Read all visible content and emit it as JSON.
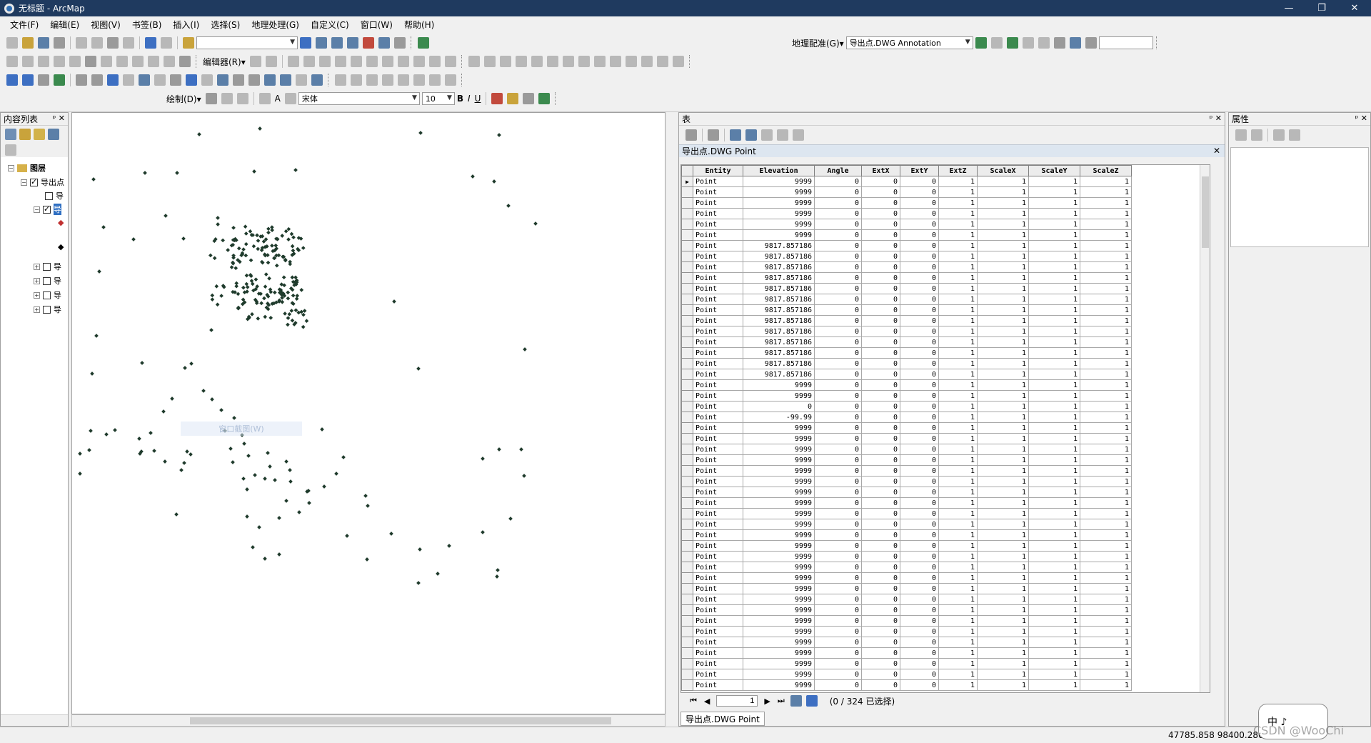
{
  "window": {
    "title": "无标题 - ArcMap",
    "minimize": "—",
    "restore": "❐",
    "close": "✕"
  },
  "menu": [
    "文件(F)",
    "编辑(E)",
    "视图(V)",
    "书签(B)",
    "插入(I)",
    "选择(S)",
    "地理处理(G)",
    "自定义(C)",
    "窗口(W)",
    "帮助(H)"
  ],
  "toolbar": {
    "georef_label": "地理配准(G)▾",
    "georef_layer": "导出点.DWG Annotation",
    "editor_label": "编辑器(R)▾",
    "draw_label": "绘制(D)▾",
    "font_name": "宋体",
    "font_size": "10",
    "bold": "B",
    "italic": "I",
    "underline": "U",
    "text_a": "A"
  },
  "toc": {
    "title": "内容列表",
    "pin": "ᵖ ✕",
    "root": "图层",
    "layer1": "导出点",
    "sublayers": [
      "导",
      "导",
      "导",
      "导",
      "导",
      "导"
    ]
  },
  "map": {
    "ghost_text": "窗口截图(W)"
  },
  "table_window": {
    "title": "表",
    "pin": "ᵖ ✕",
    "tab": "导出点.DWG Point",
    "columns": [
      "Entity",
      "Elevation",
      "Angle",
      "ExtX",
      "ExtY",
      "ExtZ",
      "ScaleX",
      "ScaleY",
      "ScaleZ"
    ],
    "rows": [
      [
        "Point",
        "9999",
        "0",
        "0",
        "0",
        "1",
        "1",
        "1",
        "1"
      ],
      [
        "Point",
        "9999",
        "0",
        "0",
        "0",
        "1",
        "1",
        "1",
        "1"
      ],
      [
        "Point",
        "9999",
        "0",
        "0",
        "0",
        "1",
        "1",
        "1",
        "1"
      ],
      [
        "Point",
        "9999",
        "0",
        "0",
        "0",
        "1",
        "1",
        "1",
        "1"
      ],
      [
        "Point",
        "9999",
        "0",
        "0",
        "0",
        "1",
        "1",
        "1",
        "1"
      ],
      [
        "Point",
        "9999",
        "0",
        "0",
        "0",
        "1",
        "1",
        "1",
        "1"
      ],
      [
        "Point",
        "9817.857186",
        "0",
        "0",
        "0",
        "1",
        "1",
        "1",
        "1"
      ],
      [
        "Point",
        "9817.857186",
        "0",
        "0",
        "0",
        "1",
        "1",
        "1",
        "1"
      ],
      [
        "Point",
        "9817.857186",
        "0",
        "0",
        "0",
        "1",
        "1",
        "1",
        "1"
      ],
      [
        "Point",
        "9817.857186",
        "0",
        "0",
        "0",
        "1",
        "1",
        "1",
        "1"
      ],
      [
        "Point",
        "9817.857186",
        "0",
        "0",
        "0",
        "1",
        "1",
        "1",
        "1"
      ],
      [
        "Point",
        "9817.857186",
        "0",
        "0",
        "0",
        "1",
        "1",
        "1",
        "1"
      ],
      [
        "Point",
        "9817.857186",
        "0",
        "0",
        "0",
        "1",
        "1",
        "1",
        "1"
      ],
      [
        "Point",
        "9817.857186",
        "0",
        "0",
        "0",
        "1",
        "1",
        "1",
        "1"
      ],
      [
        "Point",
        "9817.857186",
        "0",
        "0",
        "0",
        "1",
        "1",
        "1",
        "1"
      ],
      [
        "Point",
        "9817.857186",
        "0",
        "0",
        "0",
        "1",
        "1",
        "1",
        "1"
      ],
      [
        "Point",
        "9817.857186",
        "0",
        "0",
        "0",
        "1",
        "1",
        "1",
        "1"
      ],
      [
        "Point",
        "9817.857186",
        "0",
        "0",
        "0",
        "1",
        "1",
        "1",
        "1"
      ],
      [
        "Point",
        "9817.857186",
        "0",
        "0",
        "0",
        "1",
        "1",
        "1",
        "1"
      ],
      [
        "Point",
        "9999",
        "0",
        "0",
        "0",
        "1",
        "1",
        "1",
        "1"
      ],
      [
        "Point",
        "9999",
        "0",
        "0",
        "0",
        "1",
        "1",
        "1",
        "1"
      ],
      [
        "Point",
        "0",
        "0",
        "0",
        "0",
        "1",
        "1",
        "1",
        "1"
      ],
      [
        "Point",
        "-99.99",
        "0",
        "0",
        "0",
        "1",
        "1",
        "1",
        "1"
      ],
      [
        "Point",
        "9999",
        "0",
        "0",
        "0",
        "1",
        "1",
        "1",
        "1"
      ],
      [
        "Point",
        "9999",
        "0",
        "0",
        "0",
        "1",
        "1",
        "1",
        "1"
      ],
      [
        "Point",
        "9999",
        "0",
        "0",
        "0",
        "1",
        "1",
        "1",
        "1"
      ],
      [
        "Point",
        "9999",
        "0",
        "0",
        "0",
        "1",
        "1",
        "1",
        "1"
      ],
      [
        "Point",
        "9999",
        "0",
        "0",
        "0",
        "1",
        "1",
        "1",
        "1"
      ],
      [
        "Point",
        "9999",
        "0",
        "0",
        "0",
        "1",
        "1",
        "1",
        "1"
      ],
      [
        "Point",
        "9999",
        "0",
        "0",
        "0",
        "1",
        "1",
        "1",
        "1"
      ],
      [
        "Point",
        "9999",
        "0",
        "0",
        "0",
        "1",
        "1",
        "1",
        "1"
      ],
      [
        "Point",
        "9999",
        "0",
        "0",
        "0",
        "1",
        "1",
        "1",
        "1"
      ],
      [
        "Point",
        "9999",
        "0",
        "0",
        "0",
        "1",
        "1",
        "1",
        "1"
      ],
      [
        "Point",
        "9999",
        "0",
        "0",
        "0",
        "1",
        "1",
        "1",
        "1"
      ],
      [
        "Point",
        "9999",
        "0",
        "0",
        "0",
        "1",
        "1",
        "1",
        "1"
      ],
      [
        "Point",
        "9999",
        "0",
        "0",
        "0",
        "1",
        "1",
        "1",
        "1"
      ],
      [
        "Point",
        "9999",
        "0",
        "0",
        "0",
        "1",
        "1",
        "1",
        "1"
      ],
      [
        "Point",
        "9999",
        "0",
        "0",
        "0",
        "1",
        "1",
        "1",
        "1"
      ],
      [
        "Point",
        "9999",
        "0",
        "0",
        "0",
        "1",
        "1",
        "1",
        "1"
      ],
      [
        "Point",
        "9999",
        "0",
        "0",
        "0",
        "1",
        "1",
        "1",
        "1"
      ],
      [
        "Point",
        "9999",
        "0",
        "0",
        "0",
        "1",
        "1",
        "1",
        "1"
      ],
      [
        "Point",
        "9999",
        "0",
        "0",
        "0",
        "1",
        "1",
        "1",
        "1"
      ],
      [
        "Point",
        "9999",
        "0",
        "0",
        "0",
        "1",
        "1",
        "1",
        "1"
      ],
      [
        "Point",
        "9999",
        "0",
        "0",
        "0",
        "1",
        "1",
        "1",
        "1"
      ],
      [
        "Point",
        "9999",
        "0",
        "0",
        "0",
        "1",
        "1",
        "1",
        "1"
      ],
      [
        "Point",
        "9999",
        "0",
        "0",
        "0",
        "1",
        "1",
        "1",
        "1"
      ],
      [
        "Point",
        "9999",
        "0",
        "0",
        "0",
        "1",
        "1",
        "1",
        "1"
      ],
      [
        "Point",
        "9999",
        "0",
        "0",
        "0",
        "1",
        "1",
        "1",
        "1"
      ]
    ],
    "current_page": "1",
    "selection_status": "(0 / 324 已选择)",
    "bottom_tab": "导出点.DWG Point"
  },
  "properties": {
    "title": "属性",
    "pin": "ᵖ ✕"
  },
  "statusbar": {
    "coords": "47785.858  98400.286"
  },
  "ime": {
    "label": "中 ♪"
  },
  "watermark": "CSDN @WooChi",
  "colors": {
    "point": "#1f3b2c",
    "titlebar": "#1f3a5f"
  }
}
